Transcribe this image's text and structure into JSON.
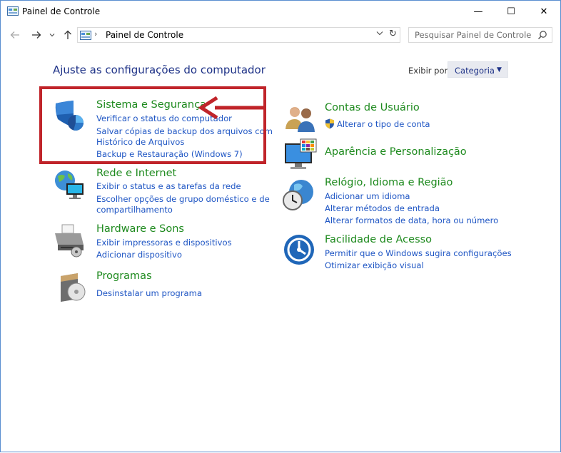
{
  "window": {
    "title": "Painel de Controle"
  },
  "window_buttons": {
    "minimize": "—",
    "maximize": "☐",
    "close": "✕"
  },
  "nav": {
    "back_icon": "arrow-left-icon",
    "forward_icon": "arrow-right-icon",
    "recent_icon": "chevron-down-icon",
    "up_icon": "arrow-up-icon",
    "breadcrumb": "Painel de Controle",
    "search_placeholder": "Pesquisar Painel de Controle"
  },
  "main": {
    "heading": "Ajuste as configurações do computador",
    "view_by_label": "Exibir por:",
    "view_by_value": "Categoria"
  },
  "categories_left": [
    {
      "title": "Sistema e Segurança",
      "icon": "shield-icon",
      "links": [
        "Verificar o status do computador",
        "Salvar cópias de backup dos arquivos com",
        "Histórico de Arquivos",
        "Backup e Restauração (Windows 7)"
      ]
    },
    {
      "title": "Rede e Internet",
      "icon": "network-globe-icon",
      "links": [
        "Exibir o status e as tarefas da rede",
        "Escolher opções de grupo doméstico e de",
        "compartilhamento"
      ]
    },
    {
      "title": "Hardware e Sons",
      "icon": "printer-icon",
      "links": [
        "Exibir impressoras e dispositivos",
        "Adicionar dispositivo"
      ]
    },
    {
      "title": "Programas",
      "icon": "programs-disc-icon",
      "links": [
        "Desinstalar um programa"
      ]
    }
  ],
  "categories_right": [
    {
      "title": "Contas de Usuário",
      "icon": "users-icon",
      "links": [
        "Alterar o tipo de conta"
      ]
    },
    {
      "title": "Aparência e Personalização",
      "icon": "monitor-palette-icon",
      "links": []
    },
    {
      "title": "Relógio, Idioma e Região",
      "icon": "clock-globe-icon",
      "links": [
        "Adicionar um idioma",
        "Alterar métodos de entrada",
        "Alterar formatos de data, hora ou número"
      ]
    },
    {
      "title": "Facilidade de Acesso",
      "icon": "ease-of-access-icon",
      "links": [
        "Permitir que o Windows sugira configurações",
        "Otimizar exibição visual"
      ]
    }
  ],
  "colors": {
    "heading": "#1e3287",
    "category_title": "#1e8a1e",
    "link": "#1f56c4",
    "annotation": "#c0242a"
  }
}
